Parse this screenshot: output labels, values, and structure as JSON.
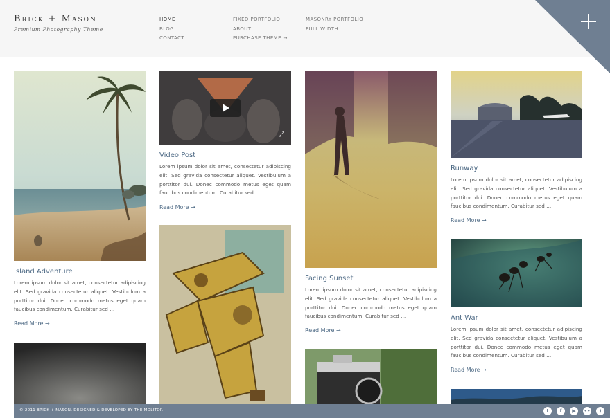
{
  "logo": {
    "title": "Brick + Mason",
    "tagline": "Premium Photography Theme"
  },
  "nav": {
    "col1": [
      "HOME",
      "BLOG",
      "CONTACT"
    ],
    "col2": [
      "FIXED PORTFOLIO",
      "ABOUT",
      "PURCHASE THEME →"
    ],
    "col3": [
      "MASONRY PORTFOLIO",
      "FULL WIDTH"
    ]
  },
  "posts": [
    {
      "title": "Island Adventure",
      "excerpt": "Lorem ipsum dolor sit amet, consectetur adipiscing elit. Sed gravida consectetur aliquet. Vestibulum a porttitor dui. Donec commodo metus eget quam faucibus condimentum. Curabitur sed …",
      "read_more": "Read More →"
    },
    {
      "title": "Video Post",
      "excerpt": "Lorem ipsum dolor sit amet, consectetur adipiscing elit. Sed gravida consectetur aliquet. Vestibulum a porttitor dui. Donec commodo metus eget quam faucibus condimentum. Curabitur sed …",
      "read_more": "Read More →"
    },
    {
      "title": "Facing Sunset",
      "excerpt": "Lorem ipsum dolor sit amet, consectetur adipiscing elit. Sed gravida consectetur aliquet. Vestibulum a porttitor dui. Donec commodo metus eget quam faucibus condimentum. Curabitur sed …",
      "read_more": "Read More →"
    },
    {
      "title": "Runway",
      "excerpt": "Lorem ipsum dolor sit amet, consectetur adipiscing elit. Sed gravida consectetur aliquet. Vestibulum a porttitor dui. Donec commodo metus eget quam faucibus condimentum. Curabitur sed …",
      "read_more": "Read More →"
    },
    {
      "title": "Ant War",
      "excerpt": "Lorem ipsum dolor sit amet, consectetur adipiscing elit. Sed gravida consectetur aliquet. Vestibulum a porttitor dui. Donec commodo metus eget quam faucibus condimentum. Curabitur sed …",
      "read_more": "Read More →"
    }
  ],
  "footer": {
    "text": "© 2011 BRICK + MASON. DESIGNED & DEVELOPED BY",
    "credit": "THE MOLITOR"
  },
  "social_icons": [
    "twitter-icon",
    "facebook-icon",
    "youtube-icon",
    "flickr-icon",
    "rss-icon"
  ],
  "colors": {
    "accent": "#4e6a85",
    "footer_bg": "#6f7f92",
    "corner": "#6f7f92"
  }
}
